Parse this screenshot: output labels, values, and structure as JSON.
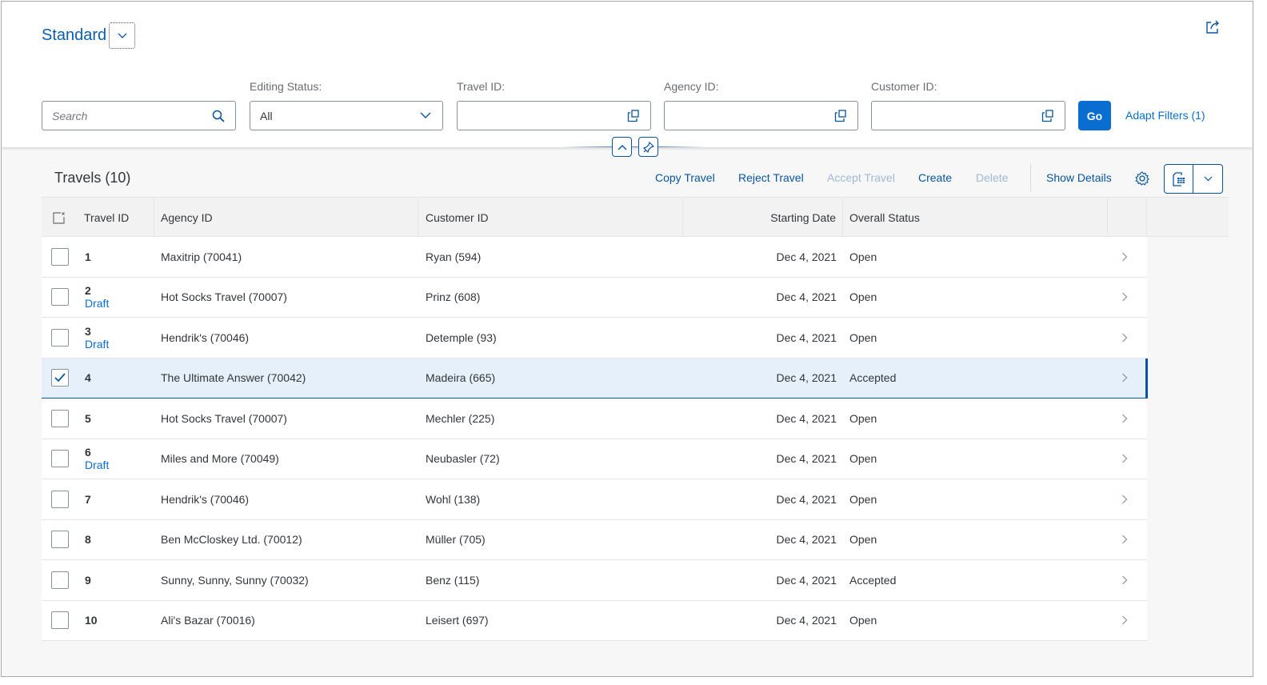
{
  "variant": {
    "title": "Standard"
  },
  "icons": {
    "variant_dropdown": "chevron-down-icon",
    "share": "share-icon",
    "search": "search-icon",
    "value_help": "value-help-icon",
    "collapse": "chevron-up-icon",
    "pin": "pin-icon",
    "settings": "gear-icon",
    "export": "export-spreadsheet-icon",
    "row_nav": "chevron-right-icon",
    "select_all": "clear-selection-icon"
  },
  "filters": {
    "search": {
      "placeholder": "Search",
      "value": ""
    },
    "editing_status": {
      "label": "Editing Status:",
      "value": "All"
    },
    "travel_id": {
      "label": "Travel ID:",
      "value": ""
    },
    "agency_id": {
      "label": "Agency ID:",
      "value": ""
    },
    "customer_id": {
      "label": "Customer ID:",
      "value": ""
    },
    "go_label": "Go",
    "adapt_label": "Adapt Filters (1)"
  },
  "table": {
    "title": "Travels (10)",
    "toolbar": {
      "copy": "Copy Travel",
      "reject": "Reject Travel",
      "accept": "Accept Travel",
      "create": "Create",
      "delete": "Delete",
      "show_details": "Show Details"
    },
    "columns": [
      "Travel ID",
      "Agency ID",
      "Customer ID",
      "Starting Date",
      "Overall Status"
    ],
    "rows": [
      {
        "id": "1",
        "draft": "",
        "agency": "Maxitrip (70041)",
        "customer": "Ryan (594)",
        "date": "Dec 4, 2021",
        "status": "Open",
        "selected": false
      },
      {
        "id": "2",
        "draft": "Draft",
        "agency": "Hot Socks Travel (70007)",
        "customer": "Prinz (608)",
        "date": "Dec 4, 2021",
        "status": "Open",
        "selected": false
      },
      {
        "id": "3",
        "draft": "Draft",
        "agency": "Hendrik's (70046)",
        "customer": "Detemple (93)",
        "date": "Dec 4, 2021",
        "status": "Open",
        "selected": false
      },
      {
        "id": "4",
        "draft": "",
        "agency": "The Ultimate Answer (70042)",
        "customer": "Madeira (665)",
        "date": "Dec 4, 2021",
        "status": "Accepted",
        "selected": true
      },
      {
        "id": "5",
        "draft": "",
        "agency": "Hot Socks Travel (70007)",
        "customer": "Mechler (225)",
        "date": "Dec 4, 2021",
        "status": "Open",
        "selected": false
      },
      {
        "id": "6",
        "draft": "Draft",
        "agency": "Miles and More (70049)",
        "customer": "Neubasler (72)",
        "date": "Dec 4, 2021",
        "status": "Open",
        "selected": false
      },
      {
        "id": "7",
        "draft": "",
        "agency": "Hendrik's (70046)",
        "customer": "Wohl (138)",
        "date": "Dec 4, 2021",
        "status": "Open",
        "selected": false
      },
      {
        "id": "8",
        "draft": "",
        "agency": "Ben McCloskey Ltd. (70012)",
        "customer": "Müller (705)",
        "date": "Dec 4, 2021",
        "status": "Open",
        "selected": false
      },
      {
        "id": "9",
        "draft": "",
        "agency": "Sunny, Sunny, Sunny (70032)",
        "customer": "Benz (115)",
        "date": "Dec 4, 2021",
        "status": "Accepted",
        "selected": false
      },
      {
        "id": "10",
        "draft": "",
        "agency": "Ali's Bazar (70016)",
        "customer": "Leisert (697)",
        "date": "Dec 4, 2021",
        "status": "Open",
        "selected": false
      }
    ]
  },
  "colors": {
    "brand": "#0a6ed1",
    "emphasized": "#0854a0",
    "selected_row": "#e5f0fa"
  }
}
